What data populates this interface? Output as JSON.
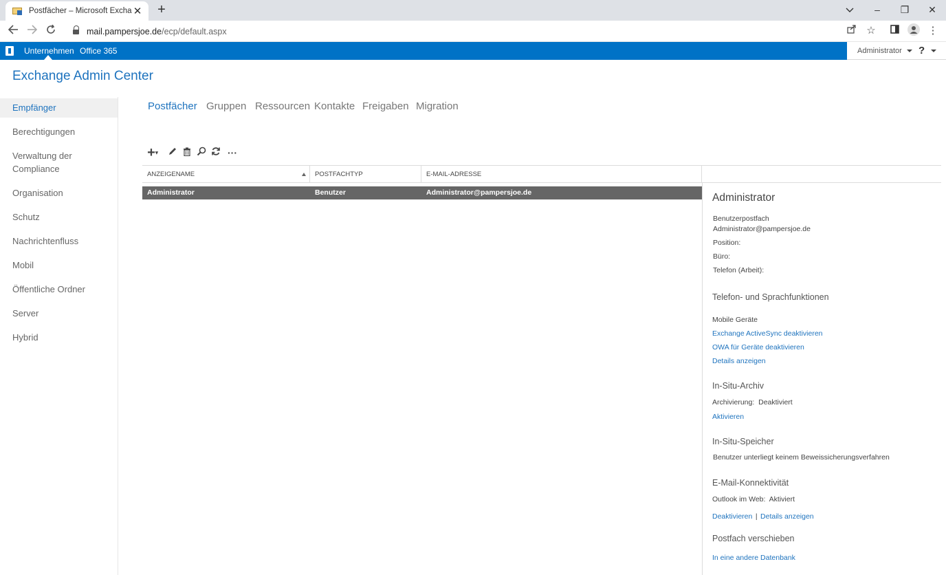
{
  "browser": {
    "tab_title": "Postfächer – Microsoft Exchange",
    "tab_close": "✕",
    "new_tab": "+",
    "url_host": "mail.pampersjoe.de",
    "url_path": "/ecp/default.aspx",
    "window_controls": {
      "minimize": "–",
      "restore": "❐",
      "close": "✕"
    }
  },
  "o365": {
    "links": [
      "Unternehmen",
      "Office 365"
    ],
    "user": "Administrator",
    "help": "?"
  },
  "app_title": "Exchange Admin Center",
  "nav": {
    "items": [
      "Empfänger",
      "Berechtigungen",
      "Verwaltung der Compliance",
      "Organisation",
      "Schutz",
      "Nachrichtenfluss",
      "Mobil",
      "Öffentliche Ordner",
      "Server",
      "Hybrid"
    ],
    "selected": "Empfänger"
  },
  "subtabs": [
    "Postfächer",
    "Gruppen",
    "Ressourcen",
    "Kontakte",
    "Freigaben",
    "Migration"
  ],
  "active_subtab": "Postfächer",
  "grid": {
    "toolbar": {
      "add": "+",
      "more": "···"
    },
    "columns": [
      "ANZEIGENAME",
      "POSTFACHTYP",
      "E-MAIL-ADRESSE"
    ],
    "rows": [
      {
        "name": "Administrator",
        "type": "Benutzer",
        "email": "Administrator@pampersjoe.de"
      }
    ]
  },
  "details": {
    "title": "Administrator",
    "mailbox_type": "Benutzerpostfach",
    "email": "Administrator@pampersjoe.de",
    "position_label": "Position:",
    "office_label": "Büro:",
    "phone_label": "Telefon (Arbeit):",
    "phone_section": {
      "heading": "Telefon- und Sprachfunktionen",
      "sub": "Mobile Geräte",
      "link1": "Exchange ActiveSync deaktivieren",
      "link2": "OWA für Geräte deaktivieren",
      "link3": "Details anzeigen"
    },
    "archive_section": {
      "heading": "In-Situ-Archiv",
      "status": "Archivierung:  Deaktiviert",
      "link": "Aktivieren"
    },
    "hold_section": {
      "heading": "In-Situ-Speicher",
      "text": "Benutzer unterliegt keinem Beweissicherungsverfahren"
    },
    "connectivity_section": {
      "heading": "E-Mail-Konnektivität",
      "status": "Outlook im Web:  Aktiviert",
      "link1": "Deaktivieren",
      "separator": "|",
      "link2": "Details anzeigen"
    },
    "move_section": {
      "heading": "Postfach verschieben",
      "link": "In eine andere Datenbank"
    }
  },
  "colors": {
    "accent": "#0072c6",
    "link": "#1e73be",
    "selected_row": "#666666"
  }
}
